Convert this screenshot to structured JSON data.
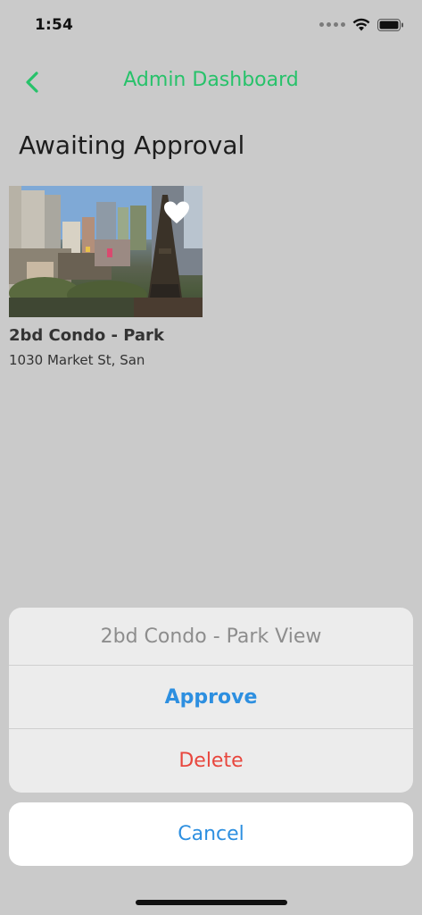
{
  "status_bar": {
    "time": "1:54"
  },
  "nav": {
    "title": "Admin Dashboard"
  },
  "section": {
    "title": "Awaiting Approval"
  },
  "listing": {
    "title": "2bd Condo - Park",
    "address": "1030 Market St, San"
  },
  "action_sheet": {
    "title": "2bd Condo - Park View",
    "approve_label": "Approve",
    "delete_label": "Delete",
    "cancel_label": "Cancel"
  },
  "colors": {
    "accent_green": "#27c26a",
    "action_blue": "#2d8fe0",
    "destructive_red": "#e8473e"
  }
}
